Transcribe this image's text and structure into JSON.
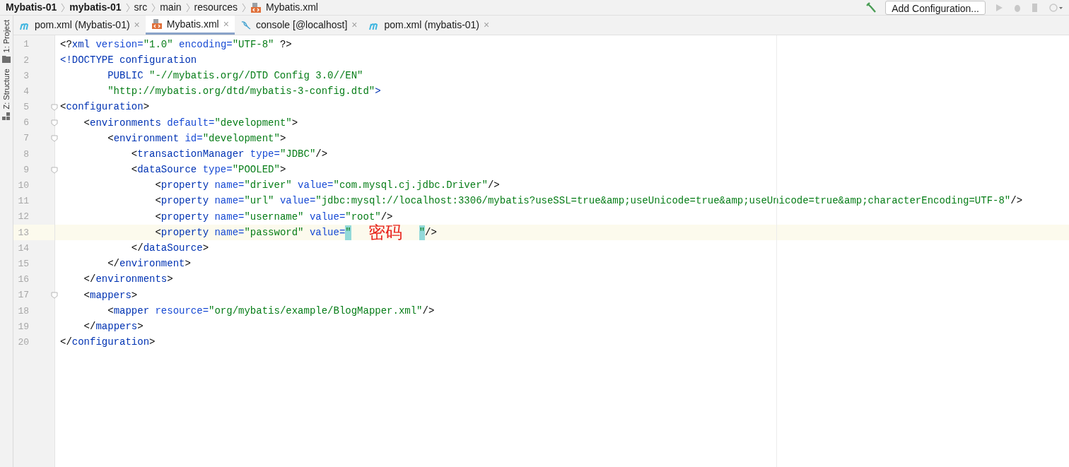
{
  "breadcrumbs": [
    {
      "label": "Mybatis-01",
      "kind": "module"
    },
    {
      "label": "mybatis-01",
      "kind": "module"
    },
    {
      "label": "src",
      "kind": "directory"
    },
    {
      "label": "main",
      "kind": "directory"
    },
    {
      "label": "resources",
      "kind": "directory"
    },
    {
      "label": "Mybatis.xml",
      "kind": "xml"
    }
  ],
  "toolbar": {
    "config_button": "Add Configuration..."
  },
  "tool_strip": [
    {
      "label": "1: Project",
      "kind": "project"
    },
    {
      "label": "Z: Structure",
      "kind": "structure"
    }
  ],
  "tabs": [
    {
      "label": "pom.xml (Mybatis-01)",
      "kind": "maven",
      "selected": false,
      "close": "×"
    },
    {
      "label": "Mybatis.xml",
      "kind": "xml",
      "selected": true,
      "close": "×"
    },
    {
      "label": "console [@localhost]",
      "kind": "console",
      "selected": false,
      "close": "×"
    },
    {
      "label": "pom.xml (mybatis-01)",
      "kind": "maven",
      "selected": false,
      "close": "×"
    }
  ],
  "lines": [
    {
      "number": "1",
      "fold": false,
      "current": false,
      "tokens": [
        {
          "kind": "punct",
          "text": "<?"
        },
        {
          "kind": "tag",
          "text": "xml"
        },
        {
          "kind": "attr",
          "text": " version="
        },
        {
          "kind": "string",
          "text": "\"1.0\""
        },
        {
          "kind": "attr",
          "text": " encoding="
        },
        {
          "kind": "string",
          "text": "\"UTF-8\""
        },
        {
          "kind": "punct",
          "text": " ?>"
        }
      ]
    },
    {
      "number": "2",
      "fold": false,
      "current": false,
      "tokens": [
        {
          "kind": "tag",
          "text": "<!DOCTYPE configuration"
        }
      ]
    },
    {
      "number": "3",
      "fold": false,
      "current": false,
      "tokens": [
        {
          "kind": "tag",
          "text": "        PUBLIC "
        },
        {
          "kind": "string",
          "text": "\"-//mybatis.org//DTD Config 3.0//EN\""
        }
      ]
    },
    {
      "number": "4",
      "fold": false,
      "current": false,
      "tokens": [
        {
          "kind": "string",
          "text": "        \"http://mybatis.org/dtd/mybatis-3-config.dtd\""
        },
        {
          "kind": "tag",
          "text": ">"
        }
      ]
    },
    {
      "number": "5",
      "fold": true,
      "current": false,
      "tokens": [
        {
          "kind": "punct",
          "text": "<"
        },
        {
          "kind": "tag",
          "text": "configuration"
        },
        {
          "kind": "punct",
          "text": ">"
        }
      ]
    },
    {
      "number": "6",
      "fold": true,
      "current": false,
      "tokens": [
        {
          "kind": "punct",
          "text": "    <"
        },
        {
          "kind": "tag",
          "text": "environments"
        },
        {
          "kind": "attr",
          "text": " default="
        },
        {
          "kind": "string",
          "text": "\"development\""
        },
        {
          "kind": "punct",
          "text": ">"
        }
      ]
    },
    {
      "number": "7",
      "fold": true,
      "current": false,
      "tokens": [
        {
          "kind": "punct",
          "text": "        <"
        },
        {
          "kind": "tag",
          "text": "environment"
        },
        {
          "kind": "attr",
          "text": " id="
        },
        {
          "kind": "string",
          "text": "\"development\""
        },
        {
          "kind": "punct",
          "text": ">"
        }
      ]
    },
    {
      "number": "8",
      "fold": false,
      "current": false,
      "tokens": [
        {
          "kind": "punct",
          "text": "            <"
        },
        {
          "kind": "tag",
          "text": "transactionManager"
        },
        {
          "kind": "attr",
          "text": " type="
        },
        {
          "kind": "string",
          "text": "\"JDBC\""
        },
        {
          "kind": "punct",
          "text": "/>"
        }
      ]
    },
    {
      "number": "9",
      "fold": true,
      "current": false,
      "tokens": [
        {
          "kind": "punct",
          "text": "            <"
        },
        {
          "kind": "tag",
          "text": "dataSource"
        },
        {
          "kind": "attr",
          "text": " type="
        },
        {
          "kind": "string",
          "text": "\"POOLED\""
        },
        {
          "kind": "punct",
          "text": ">"
        }
      ]
    },
    {
      "number": "10",
      "fold": false,
      "current": false,
      "tokens": [
        {
          "kind": "punct",
          "text": "                <"
        },
        {
          "kind": "tag",
          "text": "property"
        },
        {
          "kind": "attr",
          "text": " name="
        },
        {
          "kind": "string",
          "text": "\"driver\""
        },
        {
          "kind": "attr",
          "text": " value="
        },
        {
          "kind": "string",
          "text": "\"com.mysql.cj.jdbc.Driver\""
        },
        {
          "kind": "punct",
          "text": "/>"
        }
      ]
    },
    {
      "number": "11",
      "fold": false,
      "current": false,
      "tokens": [
        {
          "kind": "punct",
          "text": "                <"
        },
        {
          "kind": "tag",
          "text": "property"
        },
        {
          "kind": "attr",
          "text": " name="
        },
        {
          "kind": "string",
          "text": "\"url\""
        },
        {
          "kind": "attr",
          "text": " value="
        },
        {
          "kind": "string",
          "text": "\"jdbc:mysql://localhost:3306/mybatis?useSSL=true&amp;useUnicode=true&amp;useUnicode=true&amp;characterEncoding=UTF-8\""
        },
        {
          "kind": "punct",
          "text": "/>"
        }
      ]
    },
    {
      "number": "12",
      "fold": false,
      "current": false,
      "tokens": [
        {
          "kind": "punct",
          "text": "                <"
        },
        {
          "kind": "tag",
          "text": "property"
        },
        {
          "kind": "attr",
          "text": " name="
        },
        {
          "kind": "string",
          "text": "\"username\""
        },
        {
          "kind": "attr",
          "text": " value="
        },
        {
          "kind": "string",
          "text": "\"root\""
        },
        {
          "kind": "punct",
          "text": "/>"
        }
      ]
    },
    {
      "number": "13",
      "fold": false,
      "current": true,
      "tokens": [
        {
          "kind": "punct",
          "text": "                <"
        },
        {
          "kind": "tag",
          "text": "property"
        },
        {
          "kind": "attr",
          "text": " name="
        },
        {
          "kind": "string",
          "text": "\"password\""
        },
        {
          "kind": "attr",
          "text": " value="
        },
        {
          "kind": "match",
          "text": "\""
        },
        {
          "kind": "annotation",
          "text": "密码"
        },
        {
          "kind": "match",
          "text": "\""
        },
        {
          "kind": "punct",
          "text": "/>"
        }
      ]
    },
    {
      "number": "14",
      "fold": false,
      "current": false,
      "tokens": [
        {
          "kind": "punct",
          "text": "            </"
        },
        {
          "kind": "tag",
          "text": "dataSource"
        },
        {
          "kind": "punct",
          "text": ">"
        }
      ]
    },
    {
      "number": "15",
      "fold": false,
      "current": false,
      "tokens": [
        {
          "kind": "punct",
          "text": "        </"
        },
        {
          "kind": "tag",
          "text": "environment"
        },
        {
          "kind": "punct",
          "text": ">"
        }
      ]
    },
    {
      "number": "16",
      "fold": false,
      "current": false,
      "tokens": [
        {
          "kind": "punct",
          "text": "    </"
        },
        {
          "kind": "tag",
          "text": "environments"
        },
        {
          "kind": "punct",
          "text": ">"
        }
      ]
    },
    {
      "number": "17",
      "fold": true,
      "current": false,
      "tokens": [
        {
          "kind": "punct",
          "text": "    <"
        },
        {
          "kind": "tag",
          "text": "mappers"
        },
        {
          "kind": "punct",
          "text": ">"
        }
      ]
    },
    {
      "number": "18",
      "fold": false,
      "current": false,
      "tokens": [
        {
          "kind": "punct",
          "text": "        <"
        },
        {
          "kind": "tag",
          "text": "mapper"
        },
        {
          "kind": "attr",
          "text": " resource="
        },
        {
          "kind": "string",
          "text": "\"org/mybatis/example/BlogMapper.xml\""
        },
        {
          "kind": "punct",
          "text": "/>"
        }
      ]
    },
    {
      "number": "19",
      "fold": false,
      "current": false,
      "tokens": [
        {
          "kind": "punct",
          "text": "    </"
        },
        {
          "kind": "tag",
          "text": "mappers"
        },
        {
          "kind": "punct",
          "text": ">"
        }
      ]
    },
    {
      "number": "20",
      "fold": false,
      "current": false,
      "tokens": [
        {
          "kind": "punct",
          "text": "</"
        },
        {
          "kind": "tag",
          "text": "configuration"
        },
        {
          "kind": "punct",
          "text": ">"
        }
      ]
    }
  ]
}
